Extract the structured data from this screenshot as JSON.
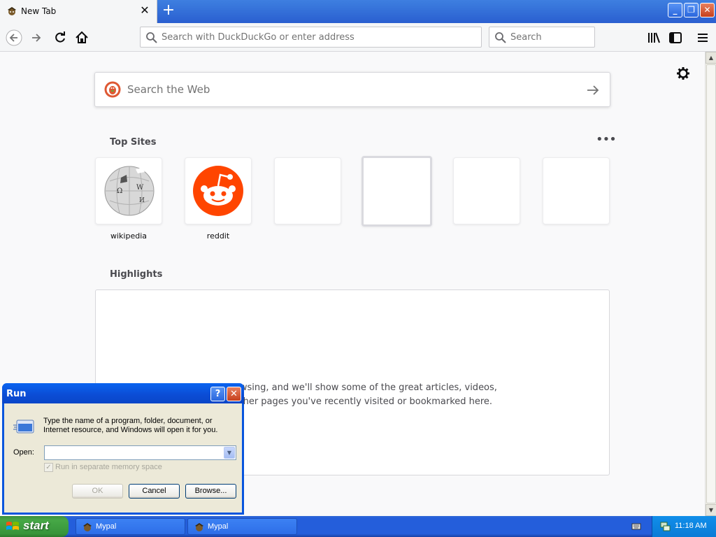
{
  "browser": {
    "tab": {
      "title": "New Tab",
      "close": "✕"
    },
    "new_tab": "+",
    "window_controls": {
      "minimize": "_",
      "restore": "❐",
      "close": "✕"
    },
    "urlbar": {
      "placeholder": "Search with DuckDuckGo or enter address"
    },
    "searchbar": {
      "placeholder": "Search"
    }
  },
  "newtab": {
    "websearch": {
      "placeholder": "Search the Web"
    },
    "top_sites": {
      "title": "Top Sites",
      "menu": "•••",
      "tiles": [
        {
          "label": "wikipedia",
          "icon": "wikipedia-globe-icon"
        },
        {
          "label": "reddit",
          "icon": "reddit-alien-icon"
        },
        {
          "label": ""
        },
        {
          "label": ""
        },
        {
          "label": ""
        },
        {
          "label": ""
        }
      ]
    },
    "highlights": {
      "title": "Highlights",
      "message": "art browsing, and we'll show some of the great articles, videos, and other pages you've recently visited or bookmarked here."
    }
  },
  "run_dialog": {
    "title": "Run",
    "help": "?",
    "close": "✕",
    "description": "Type the name of a program, folder, document, or Internet resource, and Windows will open it for you.",
    "open_label": "Open:",
    "open_value": "",
    "checkbox_label": "Run in separate memory space",
    "checkbox_checked": true,
    "ok": "OK",
    "cancel": "Cancel",
    "browse": "Browse..."
  },
  "taskbar": {
    "start": "start",
    "buttons": [
      {
        "label": "Mypal"
      },
      {
        "label": "Mypal"
      }
    ],
    "clock": "11:18 AM"
  },
  "colors": {
    "xp_blue": "#245edb",
    "start_green": "#37943a",
    "reddit_orange": "#ff4500",
    "ddg_orange": "#de5833"
  }
}
